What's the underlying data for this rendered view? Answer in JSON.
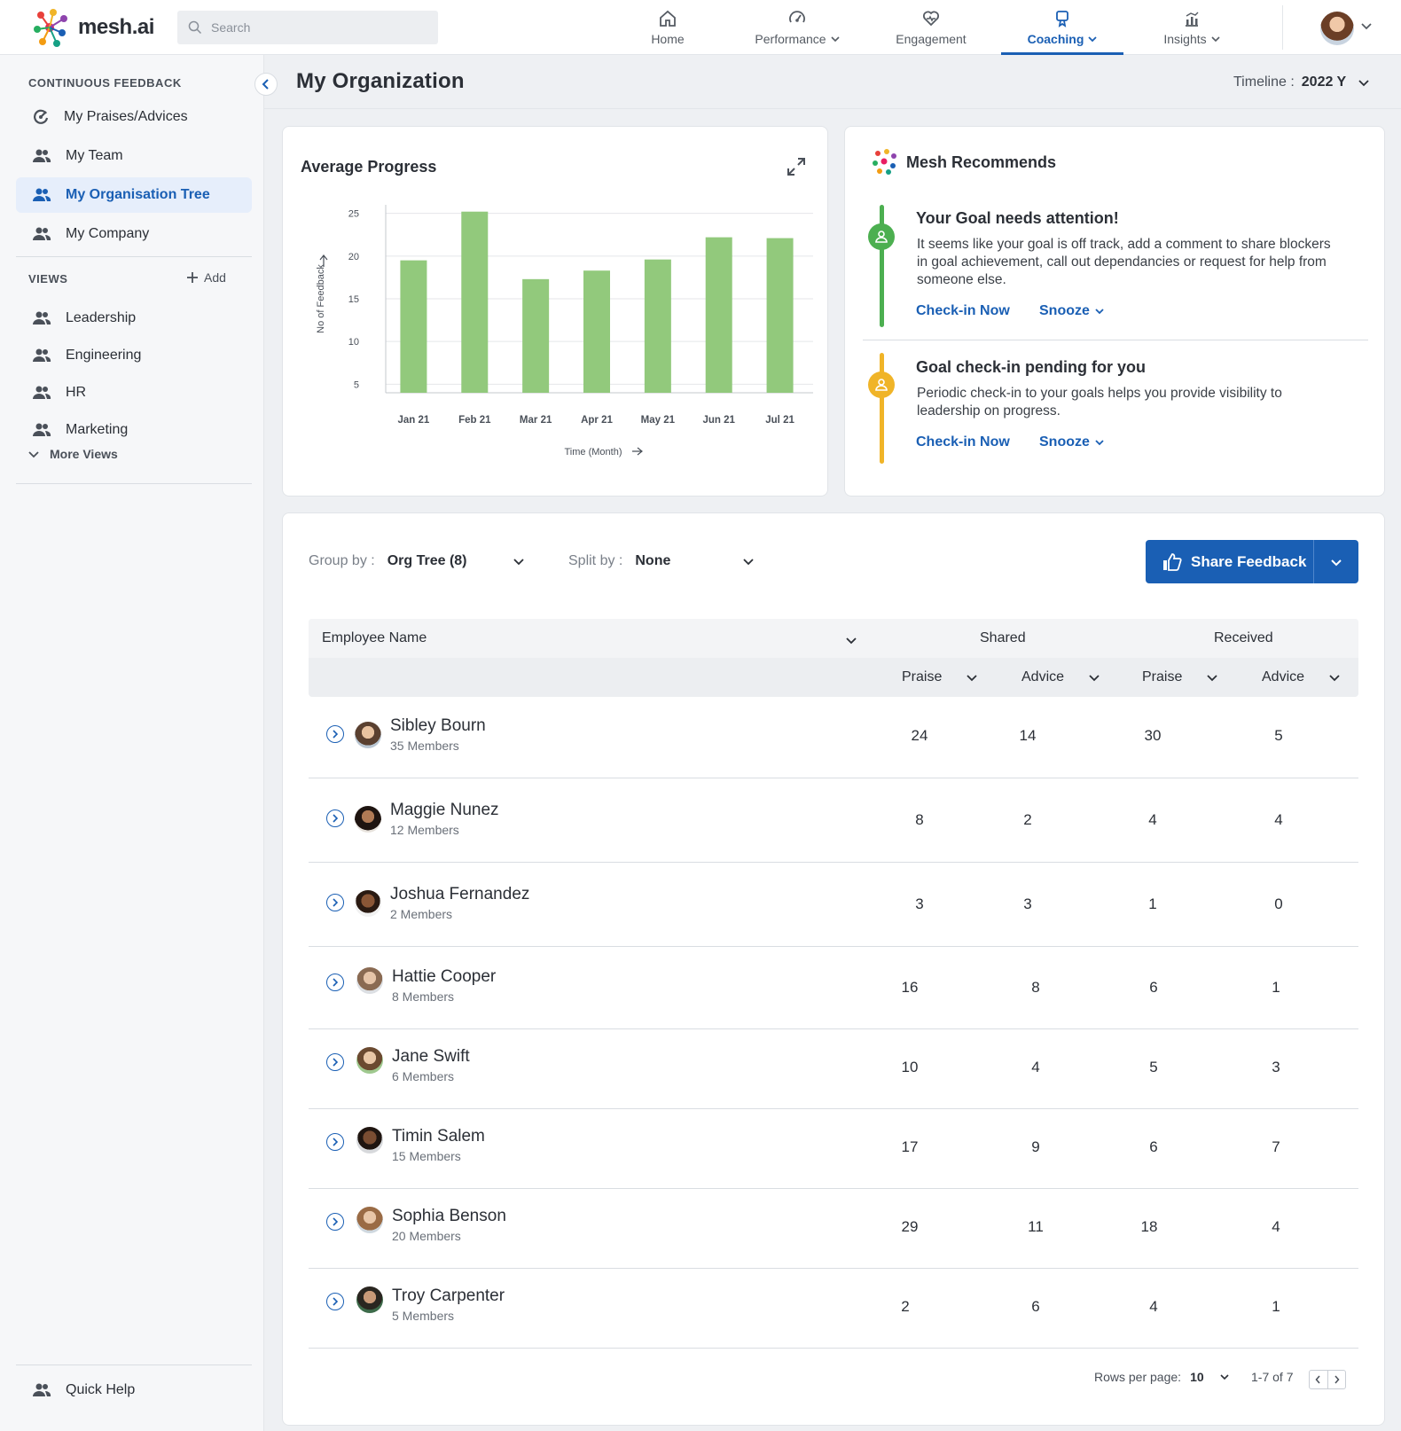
{
  "app": {
    "logo_text": "mesh.ai"
  },
  "search": {
    "placeholder": "Search"
  },
  "nav": [
    {
      "label": "Home",
      "icon": "home-icon",
      "dropdown": false
    },
    {
      "label": "Performance",
      "icon": "performance-icon",
      "dropdown": true
    },
    {
      "label": "Engagement",
      "icon": "engagement-icon",
      "dropdown": false
    },
    {
      "label": "Coaching",
      "icon": "coaching-icon",
      "dropdown": true,
      "active": true
    },
    {
      "label": "Insights",
      "icon": "insights-icon",
      "dropdown": true
    }
  ],
  "sidebar": {
    "section_feedback": "CONTINUOUS FEEDBACK",
    "feedback_items": [
      {
        "label": "My Praises/Advices",
        "icon": "praise-icon"
      },
      {
        "label": "My Team",
        "icon": "people-icon"
      },
      {
        "label": "My Organisation Tree",
        "icon": "people-icon",
        "active": true
      },
      {
        "label": "My Company",
        "icon": "people-icon"
      }
    ],
    "section_views": "VIEWS",
    "add_label": "Add",
    "view_items": [
      {
        "label": "Leadership"
      },
      {
        "label": "Engineering"
      },
      {
        "label": "HR"
      },
      {
        "label": "Marketing"
      }
    ],
    "more_views": "More Views",
    "quick_help": "Quick Help"
  },
  "header": {
    "title": "My Organization",
    "timeline_label": "Timeline :",
    "timeline_value": "2022 Y"
  },
  "progress_card": {
    "title": "Average Progress"
  },
  "chart_data": {
    "type": "bar",
    "categories": [
      "Jan 21",
      "Feb 21",
      "Mar 21",
      "Apr 21",
      "May 21",
      "Jun 21",
      "Jul 21"
    ],
    "values": [
      19.5,
      25.2,
      17.3,
      18.3,
      19.6,
      22.2,
      22.1
    ],
    "ylabel": "No of Feedback",
    "xlabel": "Time (Month)",
    "yticks": [
      5,
      10,
      15,
      20,
      25
    ],
    "ylim": [
      4,
      26
    ],
    "color": "#92c97c",
    "grid": true
  },
  "recommend": {
    "title": "Mesh Recommends",
    "items": [
      {
        "title": "Your Goal needs attention!",
        "text": "It seems like your goal is off track, add a comment to share blockers in goal achievement, call out dependancies or request for help from someone else.",
        "primary_action": "Check-in Now",
        "secondary_action": "Snooze",
        "color": "#4caf50"
      },
      {
        "title": "Goal check-in pending for you",
        "text": "Periodic check-in to your goals helps you provide visibility to leadership on progress.",
        "primary_action": "Check-in Now",
        "secondary_action": "Snooze",
        "color": "#f0b428"
      }
    ]
  },
  "table_controls": {
    "group_by_label": "Group by :",
    "group_by_value": "Org Tree (8)",
    "split_by_label": "Split by :",
    "split_by_value": "None",
    "share_button": "Share Feedback"
  },
  "table": {
    "col_name": "Employee Name",
    "group_shared": "Shared",
    "group_received": "Received",
    "sub_praise": "Praise",
    "sub_advice": "Advice",
    "rows": [
      {
        "name": "Sibley Bourn",
        "members": "35 Members",
        "shared_praise": "24",
        "shared_advice": "14",
        "received_praise": "30",
        "received_advice": "5"
      },
      {
        "name": "Maggie Nunez",
        "members": "12 Members",
        "shared_praise": "8",
        "shared_advice": "2",
        "received_praise": "4",
        "received_advice": "4"
      },
      {
        "name": "Joshua Fernandez",
        "members": "2 Members",
        "shared_praise": "3",
        "shared_advice": "3",
        "received_praise": "1",
        "received_advice": "0"
      },
      {
        "name": "Hattie Cooper",
        "members": "8 Members",
        "shared_praise": "16",
        "shared_advice": "8",
        "received_praise": "6",
        "received_advice": "1"
      },
      {
        "name": "Jane Swift",
        "members": "6 Members",
        "shared_praise": "10",
        "shared_advice": "4",
        "received_praise": "5",
        "received_advice": "3"
      },
      {
        "name": "Timin Salem",
        "members": "15 Members",
        "shared_praise": "17",
        "shared_advice": "9",
        "received_praise": "6",
        "received_advice": "7"
      },
      {
        "name": "Sophia Benson",
        "members": "20 Members",
        "shared_praise": "29",
        "shared_advice": "11",
        "received_praise": "18",
        "received_advice": "4"
      },
      {
        "name": "Troy Carpenter",
        "members": "5 Members",
        "shared_praise": "2",
        "shared_advice": "6",
        "received_praise": "4",
        "received_advice": "1"
      }
    ]
  },
  "pagination": {
    "rows_per_page_label": "Rows per page:",
    "rows_per_page_value": "10",
    "range": "1-7 of 7"
  }
}
